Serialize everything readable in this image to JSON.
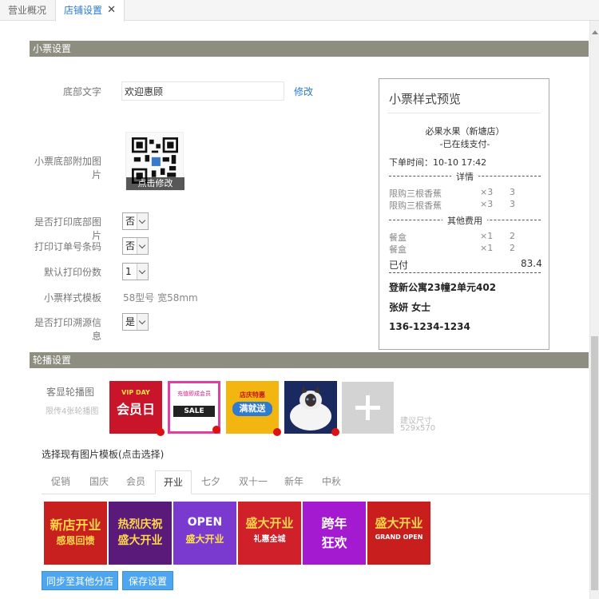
{
  "tabs": [
    {
      "label": "营业概况"
    },
    {
      "label": "店铺设置",
      "close": "✕"
    }
  ],
  "ticket_settings": {
    "section_title": "小票设置",
    "footer_text_label": "底部文字",
    "footer_text_value": "欢迎惠顾",
    "modify_link": "修改",
    "footer_image_label": "小票底部附加图片",
    "qr_caption": "点击修改",
    "print_footer_image_label": "是否打印底部图片",
    "print_footer_image_value": "否",
    "print_barcode_label": "打印订单号条码",
    "print_barcode_value": "否",
    "print_copies_label": "默认打印份数",
    "print_copies_value": "1",
    "template_label": "小票样式模板",
    "template_value": "58型号 宽58mm",
    "print_trace_label": "是否打印溯源信息",
    "print_trace_value": "是"
  },
  "preview": {
    "title": "小票样式预览",
    "shop_name": "必果水果（新塘店）",
    "paid_note": "-已在线支付-",
    "order_time": "下单时间：10-10 17:42",
    "details_label": "详情",
    "items": [
      {
        "name": "限购三根香蕉",
        "qty": "×3",
        "price": "3"
      },
      {
        "name": "限购三根香蕉",
        "qty": "×3",
        "price": "3"
      }
    ],
    "other_fees_label": "其他费用",
    "fees": [
      {
        "name": "餐盒",
        "qty": "×1",
        "price": "2"
      },
      {
        "name": "餐盒",
        "qty": "×1",
        "price": "2"
      }
    ],
    "paid_label": "已付",
    "paid_amount": "83.4",
    "address": "登新公寓23幢2单元402",
    "customer": "张妍 女士",
    "phone": "136-1234-1234"
  },
  "carousel": {
    "section_title": "轮播设置",
    "label": "客显轮播图",
    "sublabel": "限传4张轮播图",
    "banners": [
      {
        "text": "会员日",
        "sub": "VIP DAY",
        "bg": "#c9152a"
      },
      {
        "text": "SALE",
        "sub": "充值即成会员",
        "bg": "#ffffff"
      },
      {
        "text": "满就送",
        "sub": "店庆特惠",
        "bg": "#f3b510"
      },
      {
        "text": "",
        "sub": "",
        "bg": "#1a2a60"
      }
    ],
    "size_hint_1": "建议尺寸",
    "size_hint_2": "529x570",
    "choose_template": "选择现有图片模板(点击选择)",
    "categories": [
      "促销",
      "国庆",
      "会员",
      "开业",
      "七夕",
      "双十一",
      "新年",
      "中秋"
    ],
    "active_category": "开业",
    "templates": [
      {
        "text": "新店开业",
        "sub": "感恩回馈",
        "bg": "#c8201e"
      },
      {
        "text": "热烈庆祝",
        "sub": "盛大开业",
        "bg": "#5a1a7a"
      },
      {
        "text": "OPEN",
        "sub": "盛大开业",
        "bg": "#7a3ad0"
      },
      {
        "text": "盛大开业",
        "sub": "礼惠全城",
        "bg": "#d0202a"
      },
      {
        "text": "跨年",
        "sub": "狂欢",
        "bg": "#a31ad0"
      },
      {
        "text": "盛大开业",
        "sub": "GRAND OPEN",
        "bg": "#c81e1e"
      }
    ]
  },
  "buttons": {
    "sync": "同步至其他分店",
    "save": "保存设置"
  },
  "colors": {
    "section_bar": "#8e8e80",
    "link": "#2a7ad2",
    "button": "#4ea6f0"
  }
}
